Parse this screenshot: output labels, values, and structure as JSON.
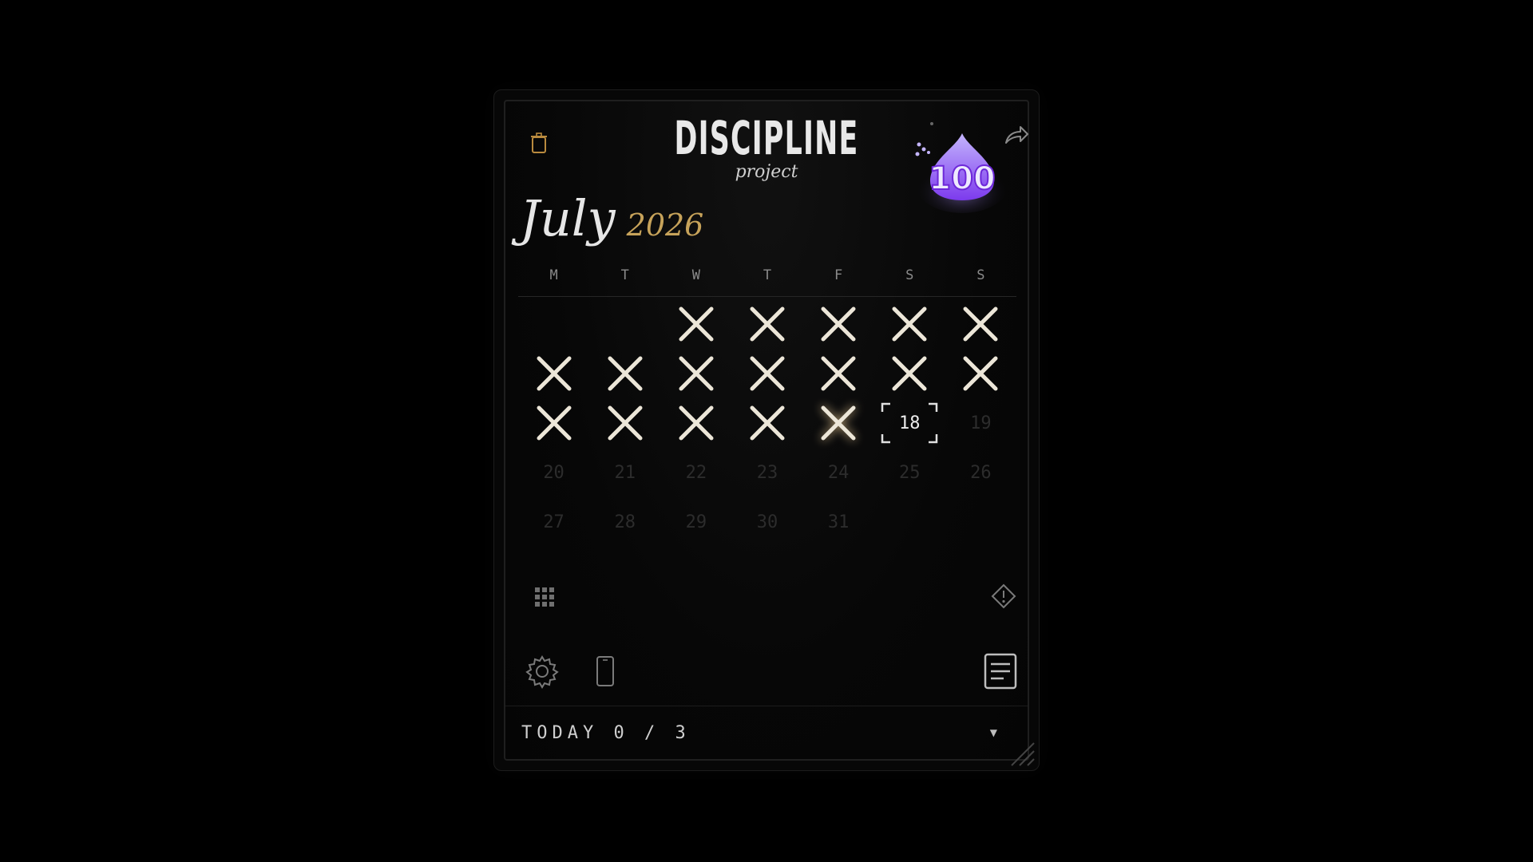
{
  "header": {
    "title": "DISCIPLINE",
    "subtitle": "project",
    "badge_value": "100"
  },
  "calendar": {
    "month": "July",
    "year": "2026",
    "weekdays": [
      "M",
      "T",
      "W",
      "T",
      "F",
      "S",
      "S"
    ],
    "today": "18",
    "upcoming_days": [
      "19",
      "20",
      "21",
      "22",
      "23",
      "24",
      "25",
      "26",
      "27",
      "28",
      "29",
      "30",
      "31"
    ]
  },
  "footer": {
    "today_label": "TODAY",
    "today_count": "0 / 3"
  },
  "colors": {
    "accent_gold": "#c7a35a",
    "badge_purple": "#8b5cf6",
    "background": "#000000"
  },
  "icons": {
    "delete": "trash-icon",
    "share": "share-icon",
    "grid": "grid-icon",
    "report": "diamond-alert-icon",
    "settings": "gear-icon",
    "device": "phone-icon",
    "notes": "notes-icon",
    "dropdown": "caret-down-icon"
  }
}
